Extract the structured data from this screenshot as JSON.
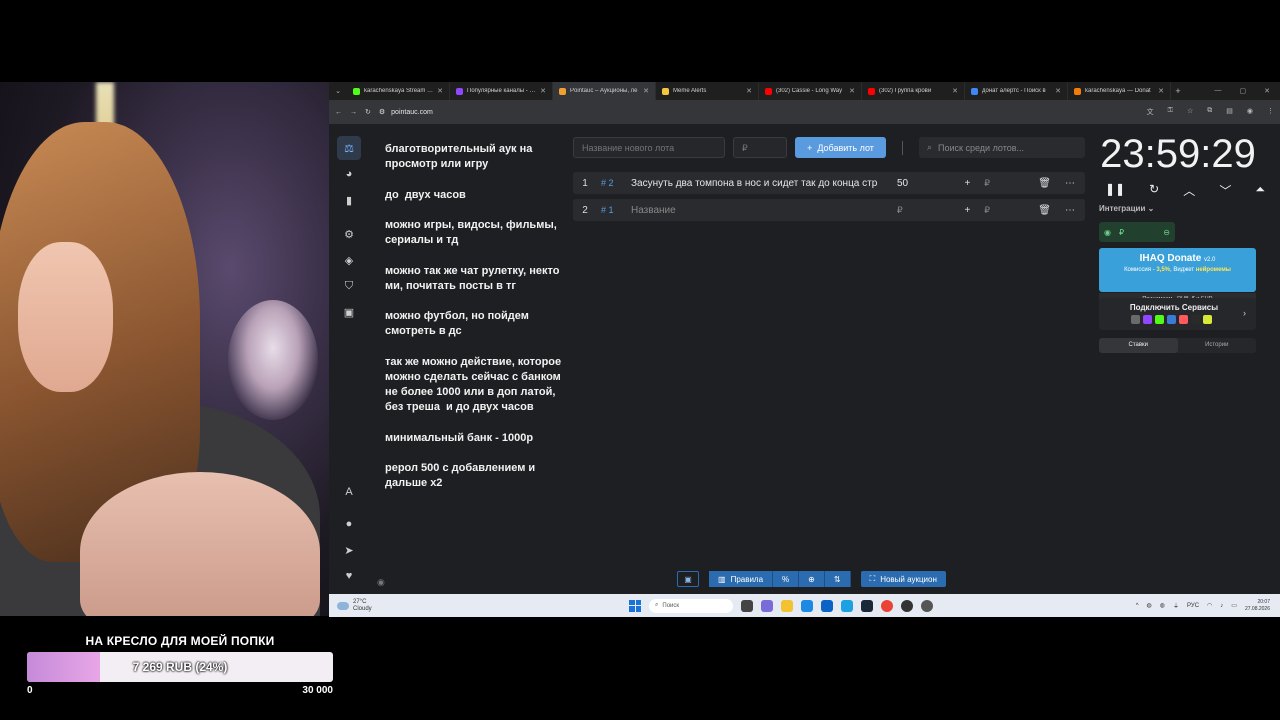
{
  "browser": {
    "tabs": [
      {
        "title": "karachenskaya Stream - V",
        "color": "#53fc18",
        "active": false
      },
      {
        "title": "Популярные каналы - Tw",
        "color": "#9146ff",
        "active": false
      },
      {
        "title": "Pointauc – Аукционы, ле",
        "color": "#f0a030",
        "active": true
      },
      {
        "title": "Meme Alerts",
        "color": "#f5c542",
        "active": false
      },
      {
        "title": "(302) Cassie - Long Way",
        "color": "#ff0000",
        "active": false
      },
      {
        "title": "(302) Группа крови",
        "color": "#ff0000",
        "active": false
      },
      {
        "title": "донат алертс - Поиск в",
        "color": "#4285f4",
        "active": false
      },
      {
        "title": "karachenskaya — Donat",
        "color": "#f57d07",
        "active": false
      }
    ],
    "url": "pointauc.com"
  },
  "rules": {
    "text": "благотворительный аук на просмотр или игру\n\nдо  двух часов\n\nможно игры, видосы, фильмы, сериалы и тд\n\nможно так же чат рулетку, некто ми, почитать посты в тг\n\nможно футбол, но пойдем смотреть в дс\n\nтак же можно действие, которое можно сделать сейчас с банком не более 1000 или в доп латой, без треша  и до двух часов\n\nминимальный банк - 1000р\n\nрерол 500 с добавлением и дальше х2"
  },
  "form": {
    "lot_placeholder": "Название нового лота",
    "price_placeholder": "₽",
    "add_label": "Добавить лот",
    "search_placeholder": "Поиск среди лотов..."
  },
  "lots": [
    {
      "num": "1",
      "idx": "# 2",
      "name": "Засунуть два томпона в нос и сидет так до конца стр",
      "amount": "50",
      "rub": "₽"
    },
    {
      "num": "2",
      "idx": "# 1",
      "name": "Название",
      "amount": "",
      "rub": "₽"
    }
  ],
  "timer": {
    "value": "23:59:29"
  },
  "integrations": {
    "label": "Интеграции ⌄",
    "rub": "₽",
    "ihaq_title": "IHAQ Donate",
    "ihaq_version": "v2.0",
    "ihaq_commission": "Комиссия - ",
    "ihaq_rate": "3,5%",
    "ihaq_widget": ", Виджет ",
    "ihaq_free": "нейромемы",
    "ihaq_accept": "Принимаем - RUB, $ и EUR",
    "connect_title": "Подключить Сервисы",
    "tab_bets": "Ставки",
    "tab_history": "Истории"
  },
  "bottom": {
    "rules_label": "Правила",
    "percent_label": "%",
    "new_auction_label": "Новый аукцион"
  },
  "taskbar": {
    "temp": "27°C",
    "weather": "Cloudy",
    "search": "Поиск",
    "lang": "РУС",
    "time": "20:07",
    "date": "27.08.2026"
  },
  "goal": {
    "title": "НА КРЕСЛО ДЛЯ МОЕЙ ПОПКИ",
    "progress_text": "7 269 RUB (24%)",
    "fraction": 0.24,
    "min": "0",
    "max": "30 000"
  }
}
